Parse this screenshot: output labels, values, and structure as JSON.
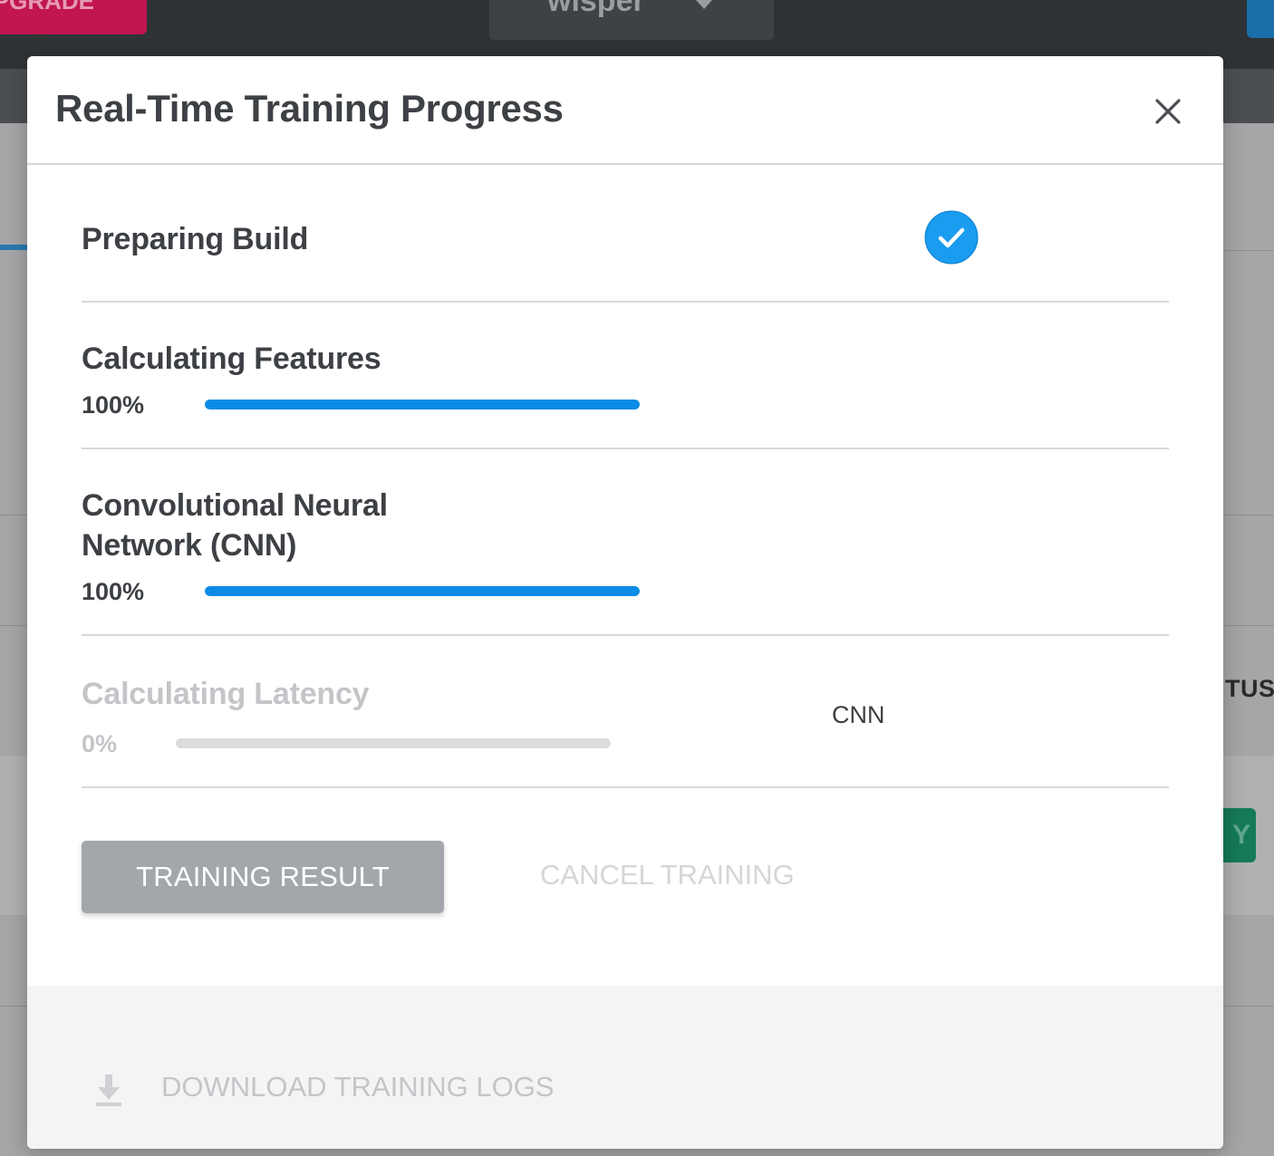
{
  "background": {
    "upgrade_label": "UPGRADE",
    "project_name": "wisper",
    "status_header_fragment": "TUS",
    "green_button_fragment": "Y"
  },
  "modal": {
    "title": "Real-Time Training Progress",
    "close_icon": "close-icon",
    "steps": [
      {
        "title": "Preparing Build",
        "status": "complete",
        "icon": "check-circle-icon"
      },
      {
        "title": "Calculating Features",
        "percent_label": "100%",
        "progress": 1.0
      },
      {
        "title_line1": "Convolutional Neural",
        "title_line2": "Network (CNN)",
        "percent_label": "100%",
        "progress": 1.0
      },
      {
        "title": "Calculating Latency",
        "percent_label": "0%",
        "progress": 0.0,
        "model_label": "CNN",
        "state": "disabled"
      }
    ],
    "actions": {
      "training_result_label": "TRAINING RESULT",
      "cancel_training_label": "CANCEL TRAINING"
    },
    "footer": {
      "download_label": "DOWNLOAD TRAINING LOGS",
      "download_icon": "download-icon"
    }
  },
  "colors": {
    "accent": "#0c8ce6",
    "check": "#1a9cf0",
    "upgrade": "#c2164f",
    "text": "#3d4044",
    "disabled_text": "#c3c5c8"
  }
}
